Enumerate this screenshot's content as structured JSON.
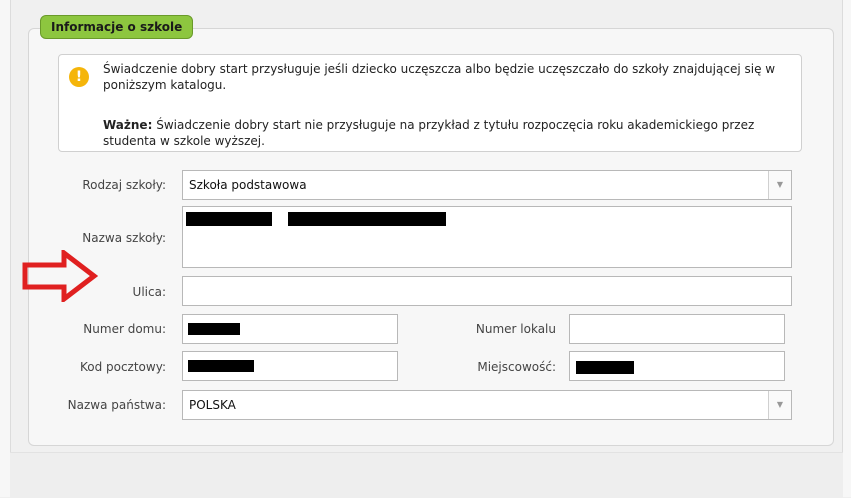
{
  "section": {
    "title": "Informacje o szkole"
  },
  "info": {
    "text1": "Świadczenie dobry start przysługuje jeśli dziecko uczęszcza albo będzie uczęszczało do szkoły znajdującej się w poniższym katalogu.",
    "important_label": "Ważne:",
    "text2": "Świadczenie dobry start nie przysługuje na przykład z tytułu rozpoczęcia roku akademickiego przez studenta w szkole wyższej.",
    "icon": "warning-icon",
    "icon_color": "#f5b50a"
  },
  "form": {
    "school_type_label": "Rodzaj szkoły:",
    "school_type_value": "Szkoła podstawowa",
    "school_name_label": "Nazwa szkoły:",
    "street_label": "Ulica:",
    "street_value": "",
    "house_number_label": "Numer domu:",
    "apartment_number_label": "Numer lokalu",
    "apartment_number_value": "",
    "postal_code_label": "Kod pocztowy:",
    "city_label": "Miejscowość:",
    "country_label": "Nazwa państwa:",
    "country_value": "POLSKA"
  },
  "colors": {
    "legend_bg": "#8dc63f",
    "arrow": "#e02020"
  }
}
